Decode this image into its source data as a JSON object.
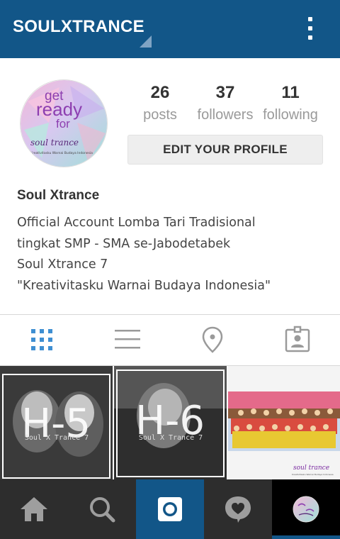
{
  "header": {
    "username": "SOULXTRANCE",
    "menu_icon": "overflow-menu-icon",
    "background": "#125688"
  },
  "profile": {
    "avatar": {
      "line1": "get",
      "line2": "ready",
      "line3": "for",
      "brand": "soul trance",
      "tagline": "Kreativitasku Warnai Budaya Indonesia"
    },
    "stats": [
      {
        "value": "26",
        "label": "posts"
      },
      {
        "value": "37",
        "label": "followers"
      },
      {
        "value": "11",
        "label": "following"
      }
    ],
    "edit_button": "EDIT YOUR PROFILE",
    "full_name": "Soul Xtrance",
    "bio": [
      "Official Account Lomba Tari Tradisional",
      "tingkat SMP - SMA se-Jabodetabek",
      "Soul Xtrance 7",
      "\"Kreativitasku Warnai Budaya Indonesia\""
    ]
  },
  "view_tabs": [
    {
      "icon": "grid-icon",
      "active": true
    },
    {
      "icon": "list-icon",
      "active": false
    },
    {
      "icon": "location-pin-icon",
      "active": false
    },
    {
      "icon": "tagged-photos-icon",
      "active": false
    }
  ],
  "posts": [
    {
      "countdown": "H-5",
      "caption": "Soul X Trance 7"
    },
    {
      "countdown": "H-6",
      "caption": "Soul X Trance 7"
    },
    {
      "brand": "soul trance",
      "tagline": "Kreativitasku Warnai Budaya Indonesia"
    }
  ],
  "bottom_nav": [
    {
      "icon": "home-icon"
    },
    {
      "icon": "search-icon"
    },
    {
      "icon": "camera-icon",
      "active_color": "#125688"
    },
    {
      "icon": "activity-heart-icon"
    },
    {
      "icon": "profile-avatar-icon",
      "active": true
    }
  ]
}
